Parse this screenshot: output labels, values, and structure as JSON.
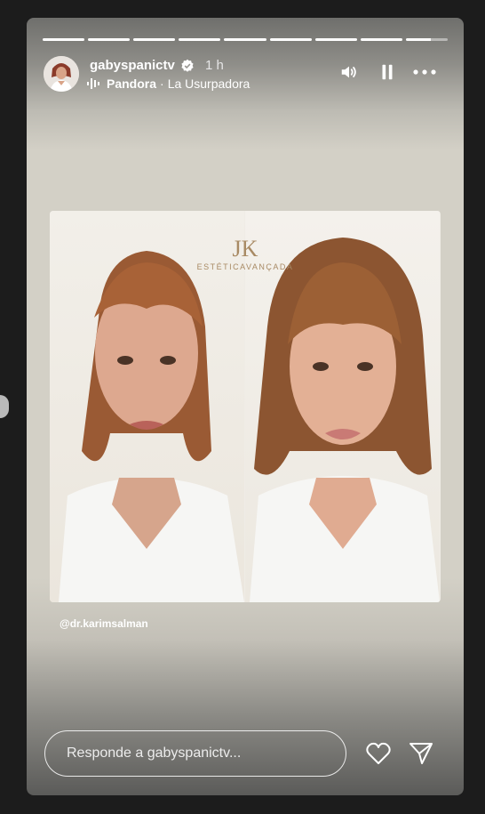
{
  "story": {
    "progress_segments": 9,
    "username": "gabyspanictv",
    "time_ago": "1 h",
    "music": {
      "song": "Pandora",
      "separator": "·",
      "artist": "La Usurpadora"
    },
    "image": {
      "brand_logo": "JK",
      "brand_text": "ESTÉTICAVANÇADA",
      "mention": "@dr.karimsalman"
    },
    "reply": {
      "placeholder": "Responde a gabyspanictv..."
    }
  },
  "icons": [
    "verified-badge-icon",
    "music-bars-icon",
    "volume-icon",
    "pause-icon",
    "more-icon",
    "heart-icon",
    "send-icon",
    "chevron-left-icon"
  ],
  "colors": {
    "accent": "#ffffff",
    "background": "#1c1c1c",
    "brand": "#a88a64"
  }
}
